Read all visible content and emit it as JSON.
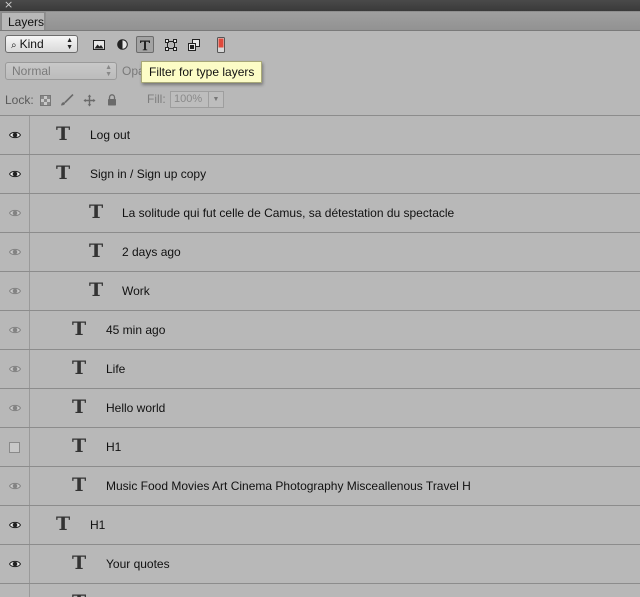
{
  "panel": {
    "tab_label": "Layers",
    "close_glyph": "×"
  },
  "filter": {
    "kind_label": "Kind",
    "icons": [
      "image-filter-icon",
      "adjustment-filter-icon",
      "type-filter-icon",
      "shape-filter-icon",
      "smart-object-filter-icon",
      "filter-toggle-icon"
    ],
    "active_icon": "type-filter-icon",
    "tooltip": "Filter for type layers"
  },
  "blend": {
    "mode": "Normal",
    "opacity_label": "Opa"
  },
  "lock": {
    "label": "Lock:",
    "icons": [
      "lock-transparent-icon",
      "lock-image-icon",
      "lock-position-icon",
      "lock-all-icon"
    ],
    "fill_label": "Fill:",
    "fill_value": "100%"
  },
  "layers": [
    {
      "name": "Log out",
      "level": 0,
      "visible": "on"
    },
    {
      "name": "Sign in / Sign up copy",
      "level": 0,
      "visible": "on"
    },
    {
      "name": "La solitude qui fut celle de Camus, sa détestation du spectacle",
      "level": 2,
      "visible": "dim"
    },
    {
      "name": "2 days ago",
      "level": 2,
      "visible": "dim"
    },
    {
      "name": "Work",
      "level": 2,
      "visible": "dim"
    },
    {
      "name": "45 min ago",
      "level": 1,
      "visible": "dim"
    },
    {
      "name": "Life",
      "level": 1,
      "visible": "dim"
    },
    {
      "name": "Hello world",
      "level": 1,
      "visible": "dim"
    },
    {
      "name": "H1",
      "level": 1,
      "visible": "off"
    },
    {
      "name": "Music Food Movies Art Cinema Photography Misceallenous Travel H",
      "level": 1,
      "visible": "dim"
    },
    {
      "name": "H1",
      "level": 0,
      "visible": "on"
    },
    {
      "name": "Your quotes",
      "level": 1,
      "visible": "on"
    },
    {
      "name": "",
      "level": 1,
      "visible": "none"
    }
  ]
}
